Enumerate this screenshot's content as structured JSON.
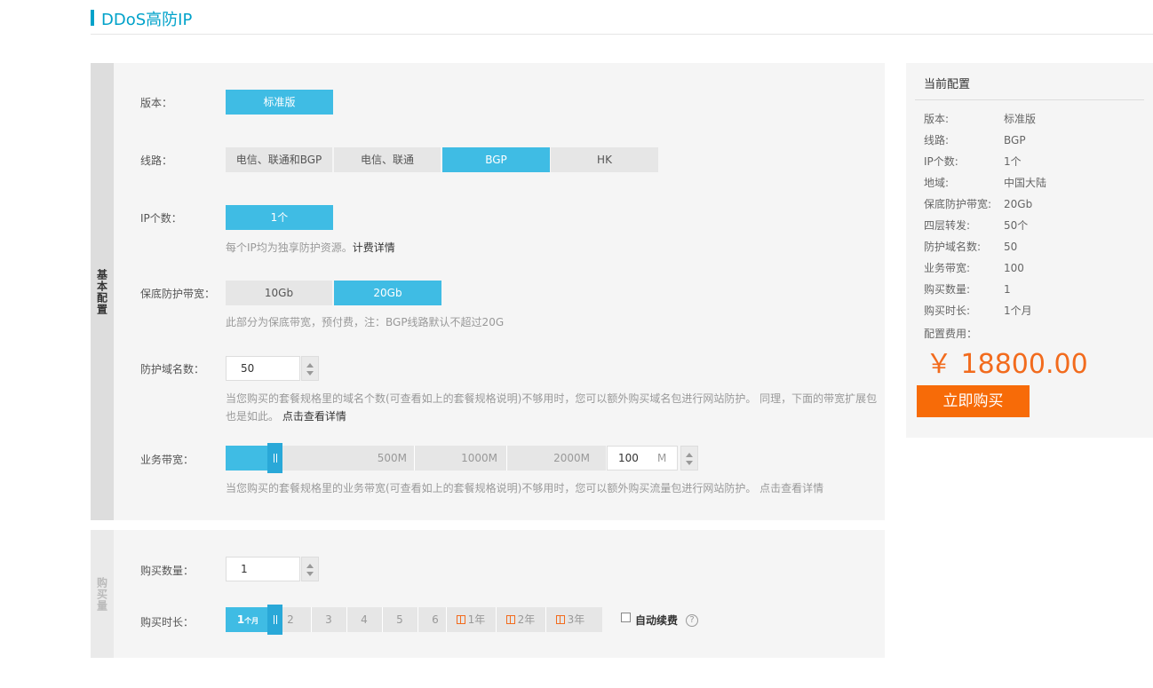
{
  "page": {
    "title": "DDoS高防IP"
  },
  "sections": {
    "basic": "基本配置",
    "purchase": "购买量"
  },
  "version": {
    "label": "版本：",
    "options": [
      "标准版"
    ],
    "selected": 0
  },
  "line": {
    "label": "线路：",
    "options": [
      "电信、联通和BGP",
      "电信、联通",
      "BGP",
      "HK"
    ],
    "selected": 2
  },
  "ip_count": {
    "label": "IP个数：",
    "options": [
      "1个"
    ],
    "selected": 0,
    "hint": "每个IP均为独享防护资源。",
    "hint_link": "计费详情"
  },
  "bandwidth": {
    "label": "保底防护带宽：",
    "options": [
      "10Gb",
      "20Gb"
    ],
    "selected": 1,
    "hint": "此部分为保底带宽，预付费，注：BGP线路默认不超过20G"
  },
  "domains": {
    "label": "防护域名数：",
    "value": "50",
    "hint": "当您购买的套餐规格里的域名个数(可查看如上的套餐规格说明)不够用时，您可以额外购买域名包进行网站防护。 同理，下面的带宽扩展包也是如此。",
    "hint_link": "点击查看详情"
  },
  "biz_bandwidth": {
    "label": "业务带宽：",
    "ticks": [
      "500M",
      "1000M",
      "2000M"
    ],
    "value": "100",
    "unit": "M",
    "hint": "当您购买的套餐规格里的业务带宽(可查看如上的套餐规格说明)不够用时，您可以额外购买流量包进行网站防护。 点击查看详情"
  },
  "quantity": {
    "label": "购买数量：",
    "value": "1"
  },
  "duration": {
    "label": "购买时长：",
    "selected_main": "1",
    "selected_unit": "个月",
    "options": [
      "2",
      "3",
      "4",
      "5",
      "6"
    ],
    "years": [
      "1年",
      "2年",
      "3年"
    ],
    "auto_renew": "自动续费",
    "help": "?"
  },
  "summary": {
    "title": "当前配置",
    "rows": [
      {
        "k": "版本:",
        "v": "标准版"
      },
      {
        "k": "线路:",
        "v": "BGP"
      },
      {
        "k": "IP个数:",
        "v": "1个"
      },
      {
        "k": "地域:",
        "v": "中国大陆"
      },
      {
        "k": "保底防护带宽:",
        "v": "20Gb"
      },
      {
        "k": "四层转发:",
        "v": "50个"
      },
      {
        "k": "防护域名数:",
        "v": "50"
      },
      {
        "k": "业务带宽:",
        "v": "100"
      },
      {
        "k": "购买数量:",
        "v": "1"
      },
      {
        "k": "购买时长:",
        "v": "1个月"
      }
    ],
    "fee_label": "配置费用：",
    "price": "￥ 18800.00",
    "buy_label": "立即购买"
  },
  "colors": {
    "accent": "#3fbce4",
    "title": "#00a2ca",
    "price": "#f26b1d",
    "buy": "#f76b08"
  }
}
